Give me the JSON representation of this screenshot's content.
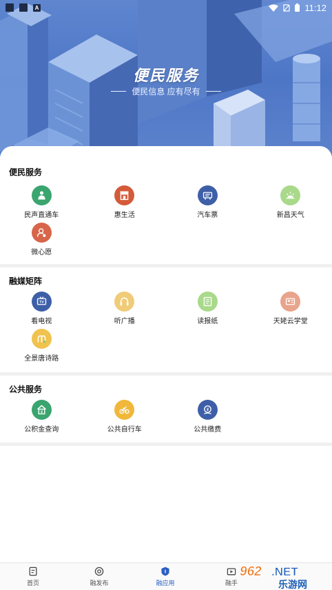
{
  "status_bar": {
    "time": "11:12",
    "a_badge": "A"
  },
  "hero": {
    "title": "便民服务",
    "subtitle": "便民信息 应有尽有"
  },
  "sections": [
    {
      "title": "便民服务",
      "items": [
        {
          "label": "民声直通车",
          "icon": "megaphone-icon",
          "color": "#3aa56e"
        },
        {
          "label": "惠生活",
          "icon": "shop-icon",
          "color": "#d45a3a"
        },
        {
          "label": "汽车票",
          "icon": "ticket-icon",
          "color": "#3e5fa8"
        },
        {
          "label": "新昌天气",
          "icon": "weather-icon",
          "color": "#a9d98a"
        },
        {
          "label": "微心愿",
          "icon": "wish-icon",
          "color": "#d7654a"
        }
      ]
    },
    {
      "title": "融媒矩阵",
      "items": [
        {
          "label": "看电视",
          "icon": "tv-icon",
          "color": "#3e5fa8"
        },
        {
          "label": "听广播",
          "icon": "headphones-icon",
          "color": "#f0cb78"
        },
        {
          "label": "读报纸",
          "icon": "newspaper-icon",
          "color": "#a9d98a"
        },
        {
          "label": "天姥云学堂",
          "icon": "classroom-icon",
          "color": "#e8a48c"
        },
        {
          "label": "全景唐诗路",
          "icon": "panorama-icon",
          "color": "#f0c24e"
        }
      ]
    },
    {
      "title": "公共服务",
      "items": [
        {
          "label": "公积金查询",
          "icon": "fund-icon",
          "color": "#3aa56e"
        },
        {
          "label": "公共自行车",
          "icon": "bicycle-icon",
          "color": "#f0b73a"
        },
        {
          "label": "公共缴费",
          "icon": "payment-icon",
          "color": "#3e5fa8"
        }
      ]
    }
  ],
  "nav": [
    {
      "label": "首页",
      "icon": "home-icon"
    },
    {
      "label": "融发布",
      "icon": "publish-icon"
    },
    {
      "label": "融应用",
      "icon": "apps-icon",
      "active": true
    },
    {
      "label": "融手",
      "icon": "media-icon"
    }
  ],
  "watermark": {
    "text_top": "962.NET",
    "text_bottom": "乐游网"
  }
}
